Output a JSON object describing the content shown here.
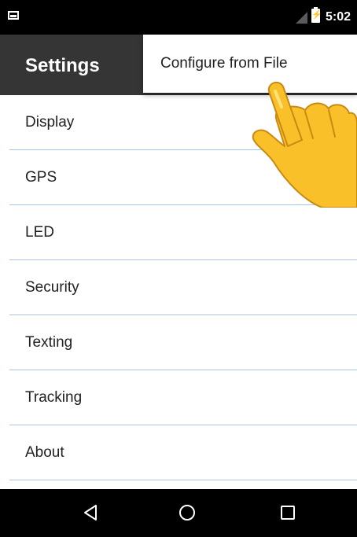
{
  "status_bar": {
    "time": "5:02",
    "notification_icon": "image-notification-icon",
    "signal_icon": "signal-icon",
    "battery_icon": "battery-charging-icon"
  },
  "action_bar": {
    "title": "Settings"
  },
  "overflow_menu": {
    "items": [
      {
        "label": "Configure from File"
      }
    ]
  },
  "settings": {
    "items": [
      {
        "label": "Display"
      },
      {
        "label": "GPS"
      },
      {
        "label": "LED"
      },
      {
        "label": "Security"
      },
      {
        "label": "Texting"
      },
      {
        "label": "Tracking"
      },
      {
        "label": "About"
      }
    ]
  },
  "nav_bar": {
    "back_icon": "back-triangle-icon",
    "home_icon": "home-circle-icon",
    "recents_icon": "recents-square-icon"
  },
  "colors": {
    "status_bar_bg": "#000000",
    "action_bar_bg": "#353535",
    "divider": "#a8c6e3",
    "text_primary": "#212121",
    "hand_fill": "#f9c02a"
  }
}
